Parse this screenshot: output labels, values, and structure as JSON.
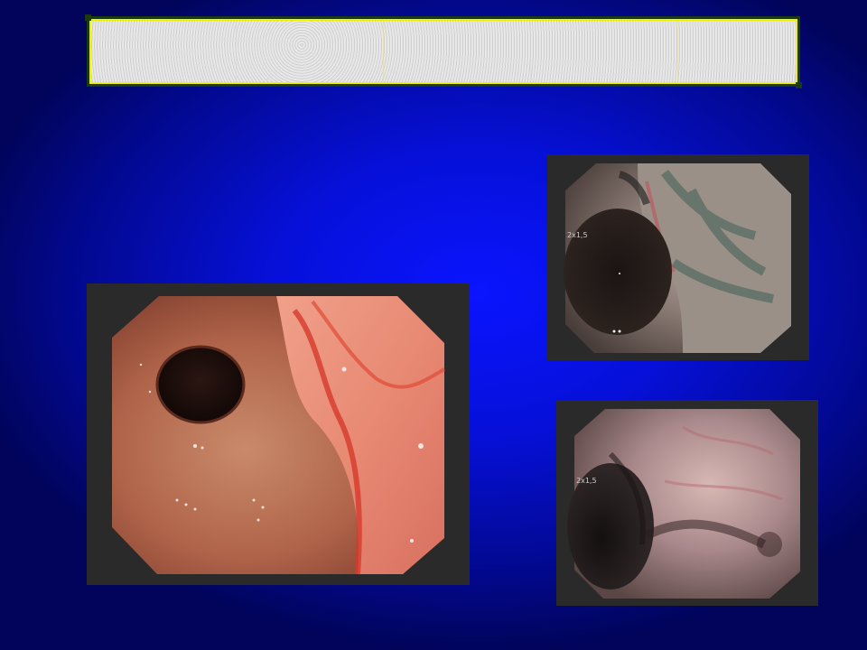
{
  "slide": {
    "title": ""
  },
  "images": {
    "large": {
      "label": ""
    },
    "top_right": {
      "label": "2x1,5"
    },
    "bottom_right": {
      "label": "2x1,5"
    }
  },
  "colors": {
    "background": "#0610d8",
    "title_border": "#f2f000"
  }
}
